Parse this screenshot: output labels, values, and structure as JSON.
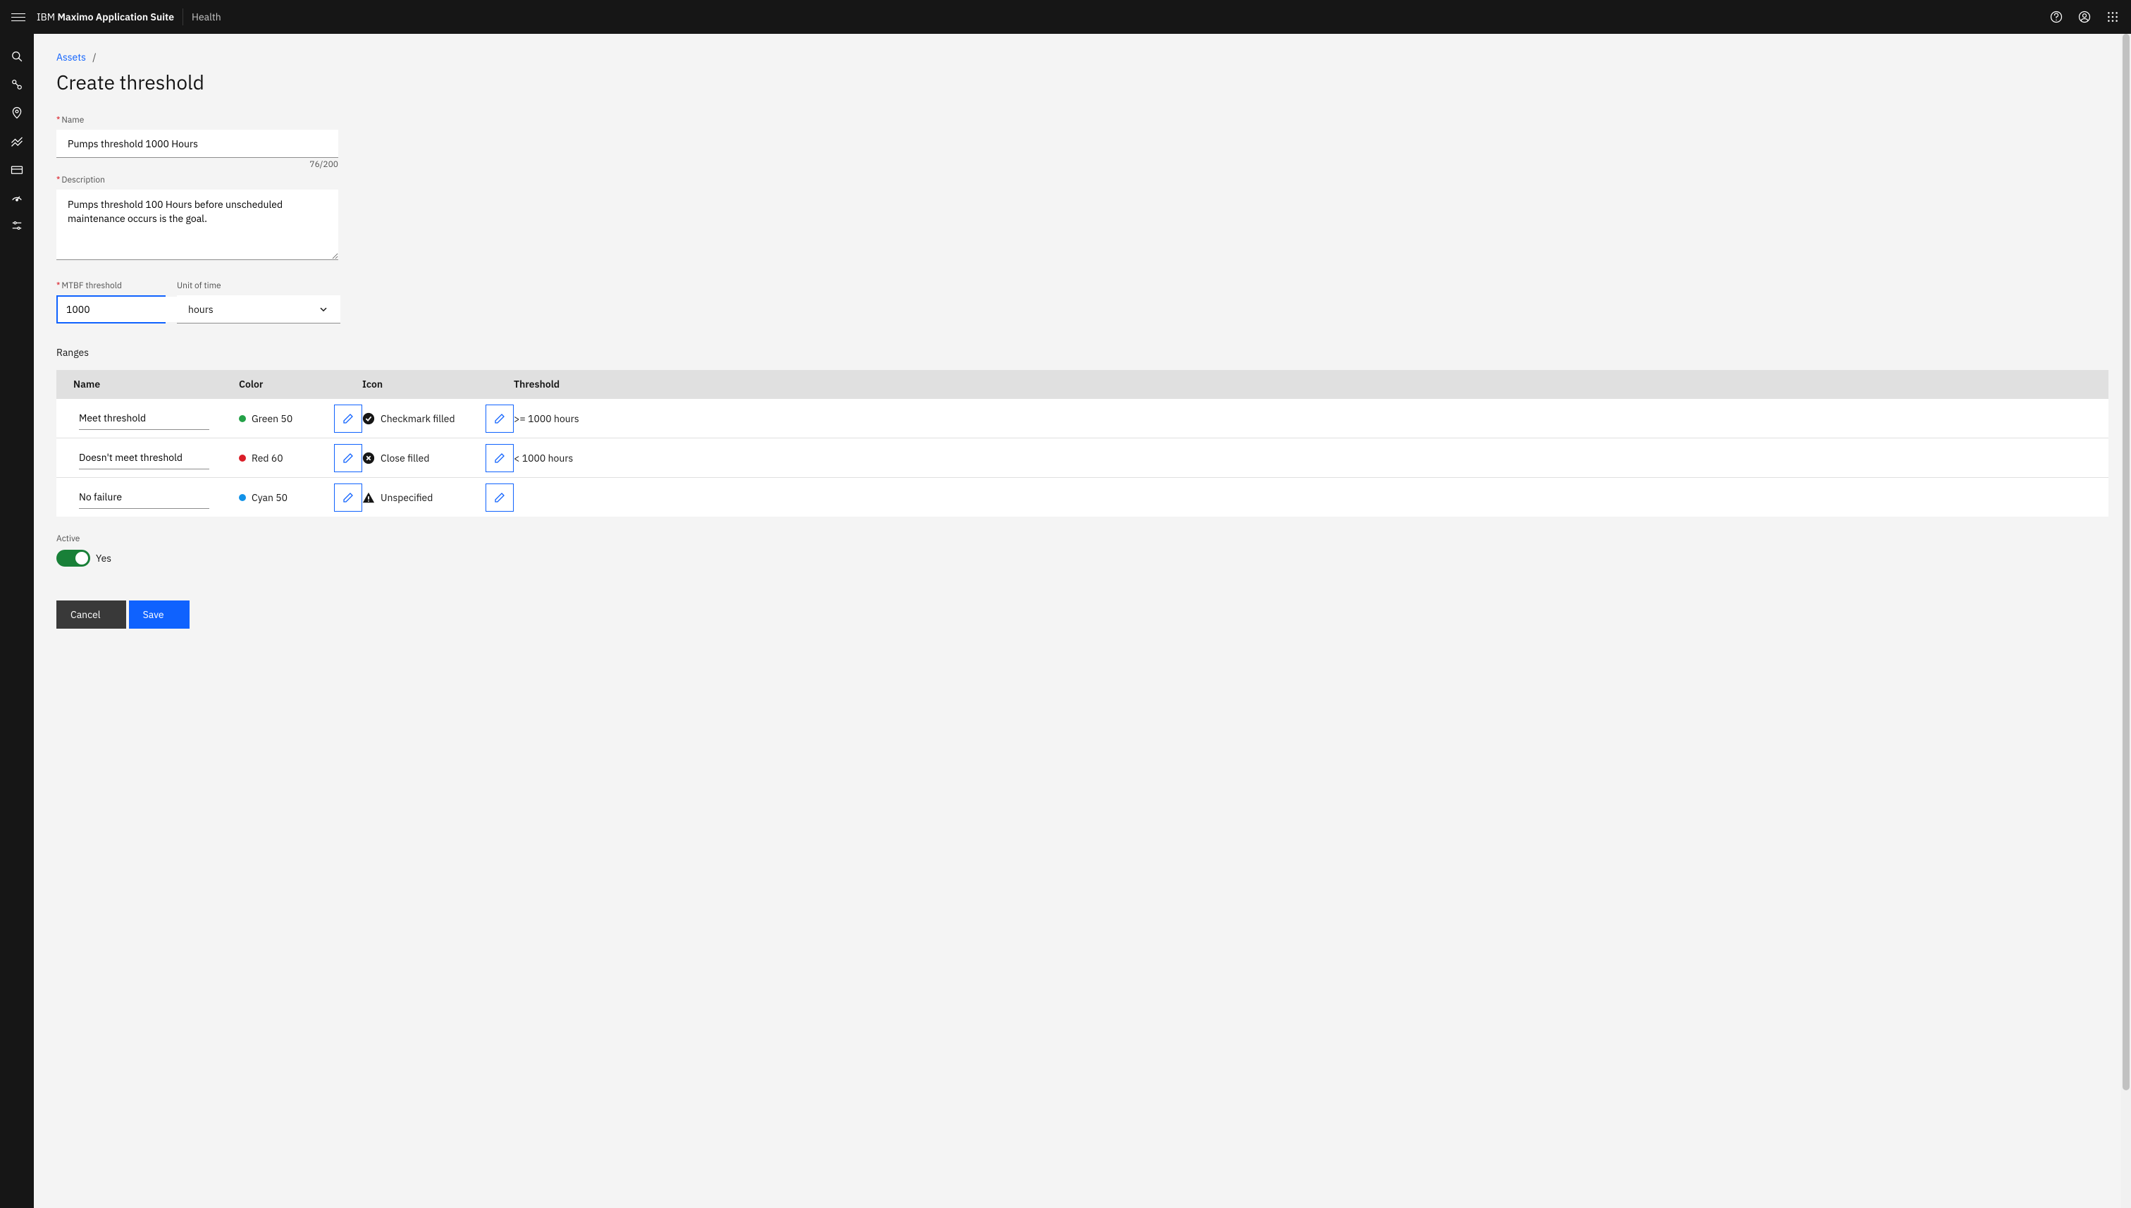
{
  "header": {
    "brand_prefix": "IBM",
    "brand_name": "Maximo Application Suite",
    "app": "Health"
  },
  "breadcrumb": {
    "items": [
      {
        "label": "Assets"
      }
    ],
    "sep": "/"
  },
  "page": {
    "title": "Create threshold"
  },
  "form": {
    "name_label": "Name",
    "name_value": "Pumps threshold 1000 Hours",
    "description_label": "Description",
    "description_value": "Pumps threshold 100 Hours before unscheduled maintenance occurs is the goal.",
    "char_count": "76/200",
    "mtbf_label": "MTBF threshold",
    "mtbf_value": "1000",
    "unit_label": "Unit of time",
    "unit_value": "hours"
  },
  "ranges": {
    "section_title": "Ranges",
    "columns": {
      "name": "Name",
      "color": "Color",
      "icon": "Icon",
      "threshold": "Threshold"
    },
    "rows": [
      {
        "name": "Meet threshold",
        "color_label": "Green 50",
        "color_hex": "#24a148",
        "icon_label": "Checkmark filled",
        "icon_type": "checkmark",
        "threshold": ">= 1000 hours"
      },
      {
        "name": "Doesn't meet threshold",
        "color_label": "Red 60",
        "color_hex": "#da1e28",
        "icon_label": "Close filled",
        "icon_type": "close",
        "threshold": "< 1000 hours"
      },
      {
        "name": "No failure",
        "color_label": "Cyan 50",
        "color_hex": "#1192e8",
        "icon_label": "Unspecified",
        "icon_type": "warning",
        "threshold": ""
      }
    ]
  },
  "active": {
    "label": "Active",
    "value_text": "Yes",
    "on": true
  },
  "footer": {
    "cancel": "Cancel",
    "save": "Save"
  }
}
